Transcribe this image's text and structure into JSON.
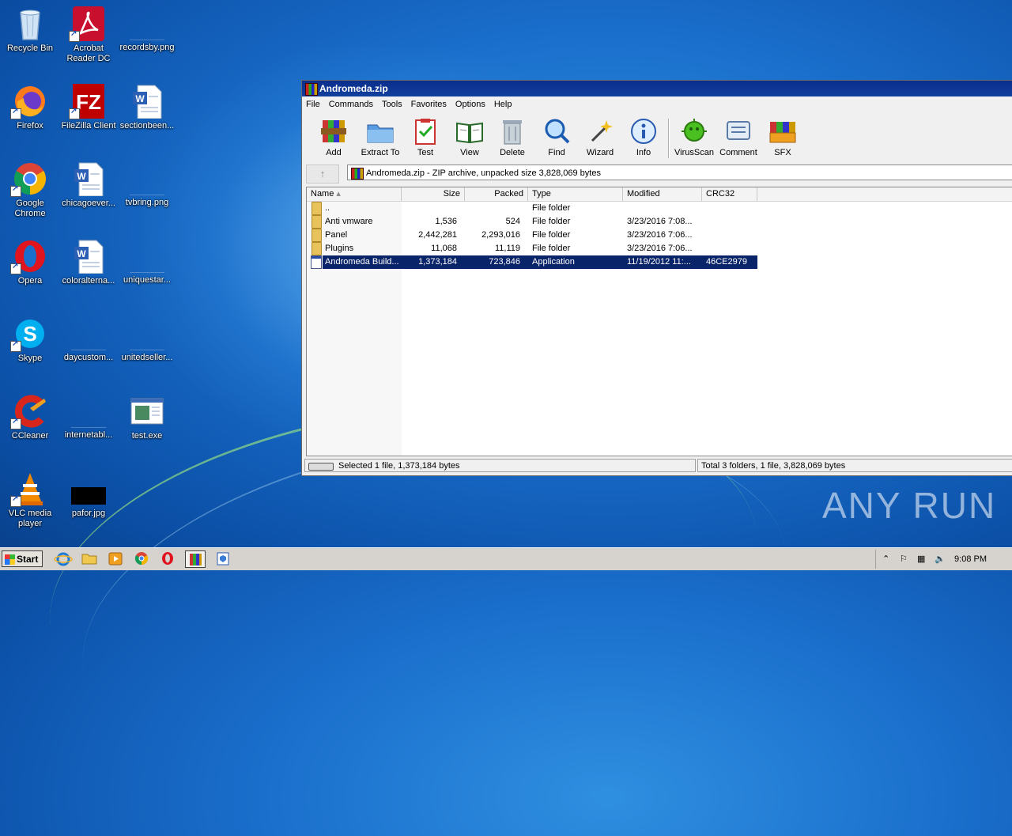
{
  "desktop": {
    "icons": [
      {
        "label": "Recycle Bin"
      },
      {
        "label": "Acrobat Reader DC"
      },
      {
        "label": "recordsby.png"
      },
      {
        "label": "Firefox"
      },
      {
        "label": "FileZilla Client"
      },
      {
        "label": "sectionbeen..."
      },
      {
        "label": "Google Chrome"
      },
      {
        "label": "chicagoever..."
      },
      {
        "label": "tvbring.png"
      },
      {
        "label": "Opera"
      },
      {
        "label": "coloralterna..."
      },
      {
        "label": "uniquestar..."
      },
      {
        "label": "Skype"
      },
      {
        "label": "daycustom..."
      },
      {
        "label": "unitedseller..."
      },
      {
        "label": "CCleaner"
      },
      {
        "label": "internetabl..."
      },
      {
        "label": "test.exe"
      },
      {
        "label": "VLC media player"
      },
      {
        "label": "pafor.jpg"
      }
    ]
  },
  "window": {
    "title": "Andromeda.zip",
    "menu": [
      "File",
      "Commands",
      "Tools",
      "Favorites",
      "Options",
      "Help"
    ],
    "toolbar": [
      "Add",
      "Extract To",
      "Test",
      "View",
      "Delete",
      "Find",
      "Wizard",
      "Info",
      "VirusScan",
      "Comment",
      "SFX"
    ],
    "address": "Andromeda.zip - ZIP archive, unpacked size 3,828,069 bytes",
    "columns": [
      "Name",
      "Size",
      "Packed",
      "Type",
      "Modified",
      "CRC32"
    ],
    "rows": [
      {
        "name": "..",
        "size": "",
        "packed": "",
        "type": "File folder",
        "modified": "",
        "crc": ""
      },
      {
        "name": "Anti vmware",
        "size": "1,536",
        "packed": "524",
        "type": "File folder",
        "modified": "3/23/2016 7:08...",
        "crc": ""
      },
      {
        "name": "Panel",
        "size": "2,442,281",
        "packed": "2,293,016",
        "type": "File folder",
        "modified": "3/23/2016 7:06...",
        "crc": ""
      },
      {
        "name": "Plugins",
        "size": "11,068",
        "packed": "11,119",
        "type": "File folder",
        "modified": "3/23/2016 7:06...",
        "crc": ""
      },
      {
        "name": "Andromeda Build...",
        "size": "1,373,184",
        "packed": "723,846",
        "type": "Application",
        "modified": "11/19/2012 11:...",
        "crc": "46CE2979"
      }
    ],
    "status_left": "Selected 1 file, 1,373,184 bytes",
    "status_right": "Total 3 folders, 1 file, 3,828,069 bytes"
  },
  "taskbar": {
    "start": "Start",
    "clock": "9:08 PM"
  },
  "watermark": "ANY RUN"
}
